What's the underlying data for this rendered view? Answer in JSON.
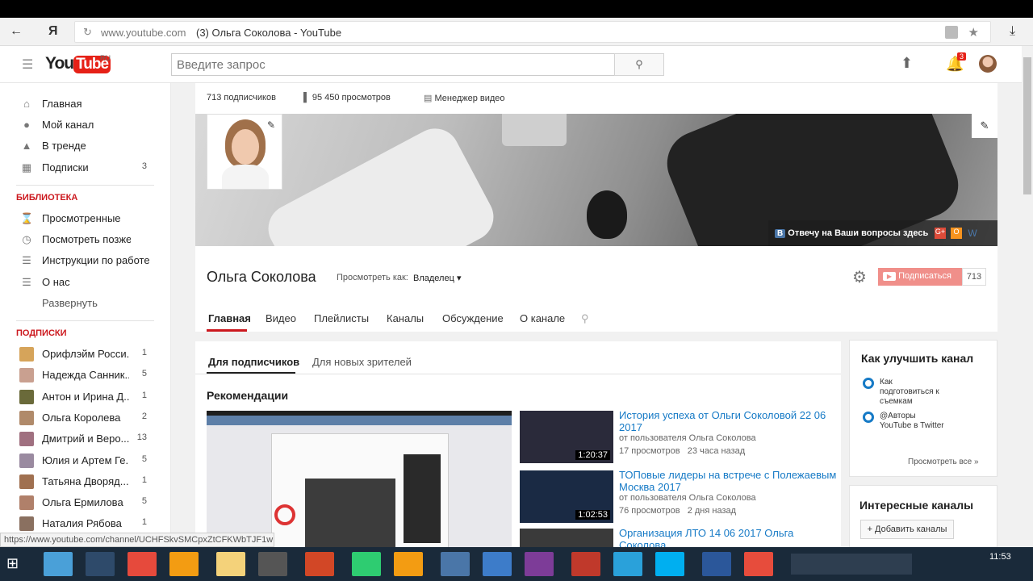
{
  "browser": {
    "back_icon": "arrow-left-icon",
    "yandex_logo": "Я",
    "url": "www.youtube.com",
    "page_title": "(3) Ольга Соколова - YouTube"
  },
  "header": {
    "logo": "You",
    "logo_tube": "Tube",
    "logo_region": "RU",
    "search_placeholder": "Введите запрос",
    "notification_count": "3"
  },
  "sidebar": {
    "main_items": [
      {
        "label": "Главная",
        "count": ""
      },
      {
        "label": "Мой канал",
        "count": ""
      },
      {
        "label": "В тренде",
        "count": ""
      },
      {
        "label": "Подписки",
        "count": "3"
      }
    ],
    "library_heading": "БИБЛИОТЕКА",
    "library_items": [
      {
        "label": "Просмотренные"
      },
      {
        "label": "Посмотреть позже"
      },
      {
        "label": "Инструкции по работе"
      },
      {
        "label": "О нас"
      }
    ],
    "expand_label": "Развернуть",
    "subs_heading": "ПОДПИСКИ",
    "subscriptions": [
      {
        "label": "Орифлэйм Росси...",
        "count": "1"
      },
      {
        "label": "Надежда Санник...",
        "count": "5"
      },
      {
        "label": "Антон и Ирина Д...",
        "count": "1"
      },
      {
        "label": "Ольга Королева",
        "count": "2"
      },
      {
        "label": "Дмитрий и Веро...",
        "count": "13"
      },
      {
        "label": "Юлия и Артем Ге...",
        "count": "5"
      },
      {
        "label": "Татьяна Двоpяд...",
        "count": "1"
      },
      {
        "label": "Ольга Ермилова",
        "count": "5"
      },
      {
        "label": "Наталия Рябова",
        "count": "1"
      }
    ]
  },
  "channel": {
    "subscribers_stat": "713 подписчиков",
    "views_stat": "95 450 просмотров",
    "video_manager": "Менеджер видео",
    "banner_link": "Отвечу на Ваши вопросы здесь",
    "name": "Ольга Соколова",
    "view_as_label": "Просмотреть как:",
    "view_as_value": "Владелец",
    "subscribe_label": "Подписаться",
    "subscribe_count": "713",
    "tabs": [
      "Главная",
      "Видео",
      "Плейлисты",
      "Каналы",
      "Обсуждение",
      "О канале"
    ]
  },
  "feed": {
    "subtabs": [
      "Для подписчиков",
      "Для новых зрителей"
    ],
    "section_title": "Рекомендации",
    "videos": [
      {
        "title": "История успеха от Ольги Соколовой 22 06 2017",
        "author": "от пользователя Ольга Соколова",
        "views": "17 просмотров",
        "age": "23 часа назад",
        "duration": "1:20:37"
      },
      {
        "title": "ТОПовые лидеры на встрече с Полежаевым Москва 2017",
        "author": "от пользователя Ольга Соколова",
        "views": "76 просмотров",
        "age": "2 дня назад",
        "duration": "1:02:53"
      },
      {
        "title": "Организация ЛТО 14 06 2017 Ольга Соколова",
        "author": "",
        "views": "",
        "age": "",
        "duration": ""
      }
    ]
  },
  "right_panel": {
    "improve_title": "Как улучшить канал",
    "tips": [
      "Как подготовиться к съемкам",
      "@Авторы YouTube в Twitter"
    ],
    "see_all": "Просмотреть все",
    "interesting_title": "Интересные каналы",
    "add_channels": "+ Добавить каналы"
  },
  "status_url": "https://www.youtube.com/channel/UCHFSkvSMCpxZtCFKWbTJF1w",
  "taskbar": {
    "time": "11:53"
  },
  "colors": {
    "yt_red": "#e62117",
    "link_blue": "#167ac6",
    "section_red": "#cc181e"
  }
}
